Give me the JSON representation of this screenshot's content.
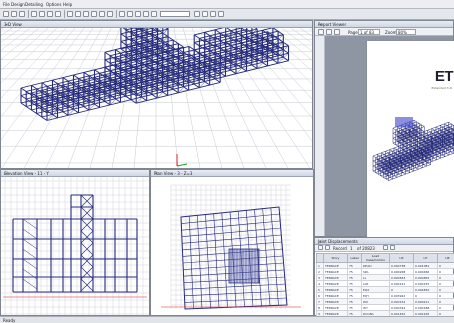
{
  "menu": [
    "File",
    "Design",
    "Detailing",
    "Options",
    "Help"
  ],
  "panels": {
    "view3d": {
      "title": "3-D View"
    },
    "report": {
      "title": "Report Viewer"
    },
    "elevation": {
      "title": "Elevation View - 11 - Y"
    },
    "plan": {
      "title": "Plan View - 3 - Z=3"
    },
    "tables": {
      "title": "Joint Displacements"
    }
  },
  "report": {
    "page_label": "Page",
    "page_value": "1 of 83",
    "zoom_label": "Zoom",
    "zoom_value": "80%",
    "logo_text": "ET",
    "subtitle": "Extended 3-D"
  },
  "tables": {
    "record_label": "Record",
    "record_value": "1",
    "of_label": "of 20823",
    "columns": [
      "",
      "Story",
      "Label",
      "Load Case/Combo",
      "UX",
      "UY",
      "UZ"
    ],
    "rows": [
      [
        "1",
        "TERRACE",
        "75",
        "DEAD",
        "0.000738",
        "0.001081",
        "0"
      ],
      [
        "2",
        "TERRACE",
        "75",
        "SDL",
        "0.000268",
        "0.000466",
        "0"
      ],
      [
        "3",
        "TERRACE",
        "75",
        "LL",
        "0.000563",
        "0.000852",
        "0"
      ],
      [
        "4",
        "TERRACE",
        "75",
        "LLR",
        "0.000121",
        "0.000155",
        "0"
      ],
      [
        "5",
        "TERRACE",
        "75",
        "EQX",
        "0",
        "0.004832",
        "0"
      ],
      [
        "6",
        "TERRACE",
        "75",
        "EQY",
        "0.003942",
        "0",
        "0"
      ],
      [
        "7",
        "TERRACE",
        "75",
        "WX",
        "0.000154",
        "0.000211",
        "0"
      ],
      [
        "8",
        "TERRACE",
        "75",
        "WY",
        "0.000344",
        "0.000188",
        "0"
      ],
      [
        "9",
        "TERRACE",
        "75",
        "DCON1",
        "0.001452",
        "0.002165",
        "0"
      ],
      [
        "10",
        "TERRACE",
        "75",
        "DCON2",
        "0.002011",
        "0.003043",
        "0"
      ]
    ]
  },
  "status": {
    "text": "Ready"
  },
  "colors": {
    "frame": "#262b7a",
    "frame_light": "#4a52a8",
    "grid": "#c5c9d2"
  }
}
